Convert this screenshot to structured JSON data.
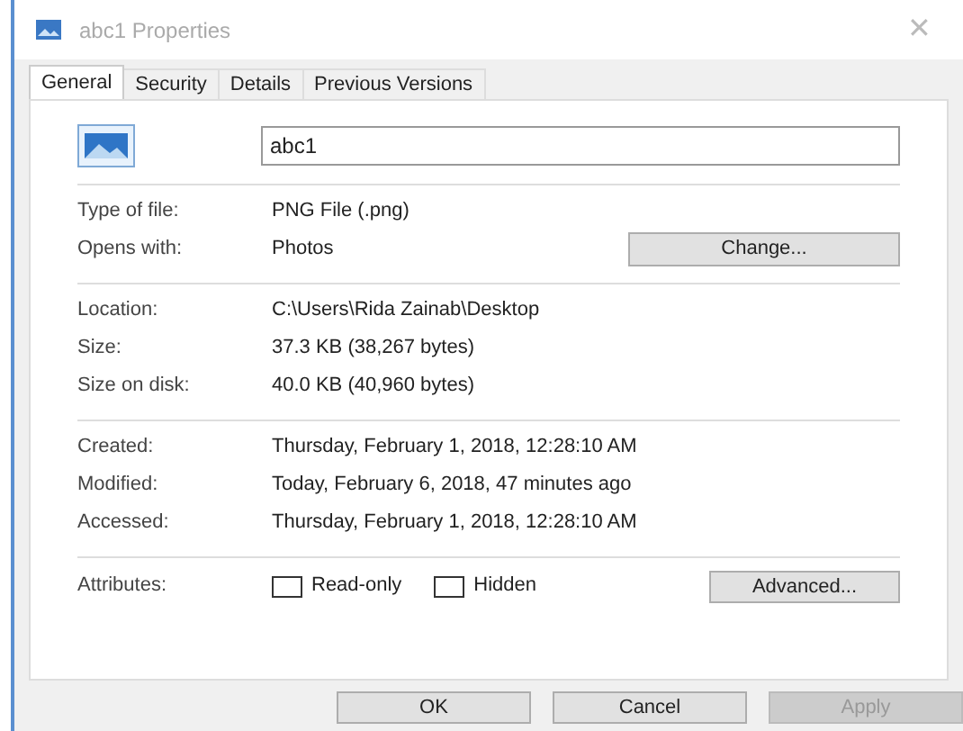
{
  "window": {
    "title": "abc1 Properties",
    "close": "✕"
  },
  "tabs": [
    {
      "label": "General",
      "selected": true
    },
    {
      "label": "Security",
      "selected": false
    },
    {
      "label": "Details",
      "selected": false
    },
    {
      "label": "Previous Versions",
      "selected": false
    }
  ],
  "file_name": "abc1",
  "sections": [
    {
      "rows": [
        {
          "label": "Type of file:",
          "value": "PNG File (.png)"
        },
        {
          "label": "Opens with:",
          "value": "Photos",
          "button": "Change..."
        }
      ]
    },
    {
      "rows": [
        {
          "label": "Location:",
          "value": "C:\\Users\\Rida Zainab\\Desktop"
        },
        {
          "label": "Size:",
          "value": "37.3 KB (38,267 bytes)"
        },
        {
          "label": "Size on disk:",
          "value": "40.0 KB (40,960 bytes)"
        }
      ]
    },
    {
      "rows": [
        {
          "label": "Created:",
          "value": "Thursday, February 1, 2018, 12:28:10 AM"
        },
        {
          "label": "Modified:",
          "value": "Today, February 6, 2018, 47 minutes ago"
        },
        {
          "label": "Accessed:",
          "value": "Thursday, February 1, 2018, 12:28:10 AM"
        }
      ]
    }
  ],
  "attributes": {
    "label": "Attributes:",
    "checkboxes": [
      {
        "label": "Read-only",
        "checked": false
      },
      {
        "label": "Hidden",
        "checked": false
      }
    ],
    "button": "Advanced..."
  },
  "buttons": [
    {
      "label": "OK",
      "disabled": false
    },
    {
      "label": "Cancel",
      "disabled": false
    },
    {
      "label": "Apply",
      "disabled": true
    }
  ]
}
